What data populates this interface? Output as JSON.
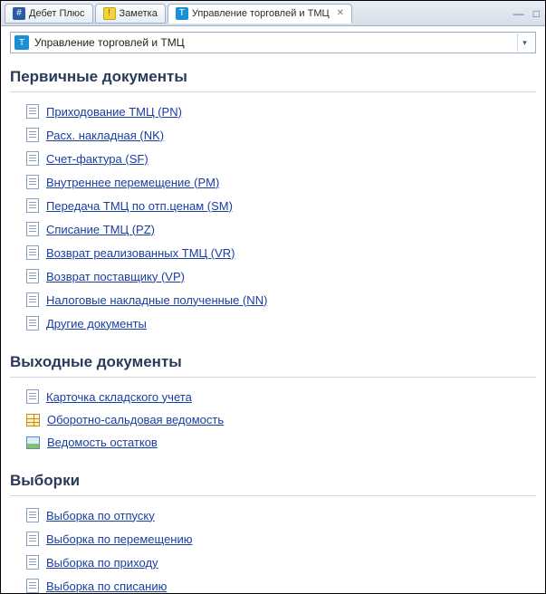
{
  "tabs": [
    {
      "label": "Дебет Плюс",
      "icon": "debit",
      "active": false,
      "closable": false
    },
    {
      "label": "Заметка",
      "icon": "note",
      "active": false,
      "closable": false
    },
    {
      "label": "Управление торговлей и ТМЦ",
      "icon": "trade",
      "active": true,
      "closable": true
    }
  ],
  "dropdown": {
    "label": "Управление торговлей и ТМЦ"
  },
  "sections": [
    {
      "title": "Первичные документы",
      "items": [
        {
          "label": "Приходование ТМЦ (PN)",
          "icon": "doc"
        },
        {
          "label": "Расх. накладная (NK)",
          "icon": "doc"
        },
        {
          "label": "Счет-фактура (SF)",
          "icon": "doc"
        },
        {
          "label": "Внутреннее перемещение (PM)",
          "icon": "doc"
        },
        {
          "label": "Передача ТМЦ по отп.ценам (SM)",
          "icon": "doc"
        },
        {
          "label": "Списание ТМЦ (PZ)",
          "icon": "doc"
        },
        {
          "label": "Возврат реализованных ТМЦ (VR)",
          "icon": "doc"
        },
        {
          "label": "Возврат поставщику (VP)",
          "icon": "doc"
        },
        {
          "label": "Налоговые накладные полученные (NN)",
          "icon": "doc"
        },
        {
          "label": "Другие документы",
          "icon": "doc"
        }
      ]
    },
    {
      "title": "Выходные документы",
      "items": [
        {
          "label": "Карточка складского учета",
          "icon": "doc"
        },
        {
          "label": "Оборотно-сальдовая ведомость",
          "icon": "table"
        },
        {
          "label": "Ведомость остатков",
          "icon": "img"
        }
      ]
    },
    {
      "title": "Выборки",
      "items": [
        {
          "label": "Выборка по отпуску",
          "icon": "doc"
        },
        {
          "label": "Выборка по перемещению",
          "icon": "doc"
        },
        {
          "label": "Выборка по приходу",
          "icon": "doc"
        },
        {
          "label": "Выборка по списанию",
          "icon": "doc"
        }
      ]
    }
  ]
}
